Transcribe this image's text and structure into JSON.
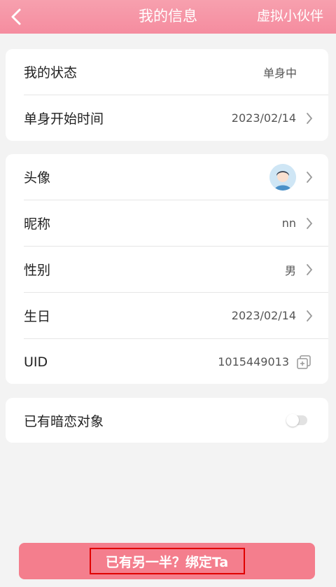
{
  "colors": {
    "accent": "#f58c9f",
    "button": "#f47e8d",
    "highlight": "#e00000"
  },
  "header": {
    "title": "我的信息",
    "right_action": "虚拟小伙伴",
    "back_icon": "chevron-left-icon"
  },
  "status_card": {
    "status_label": "我的状态",
    "status_value": "单身中",
    "start_label": "单身开始时间",
    "start_value": "2023/02/14"
  },
  "profile_card": {
    "avatar_label": "头像",
    "nickname_label": "昵称",
    "nickname_value": "nn",
    "gender_label": "性别",
    "gender_value": "男",
    "birthday_label": "生日",
    "birthday_value": "2023/02/14",
    "uid_label": "UID",
    "uid_value": "1015449013"
  },
  "crush_card": {
    "label": "已有暗恋对象",
    "enabled": false
  },
  "bind_button": {
    "label": "已有另一半？绑定Ta"
  }
}
